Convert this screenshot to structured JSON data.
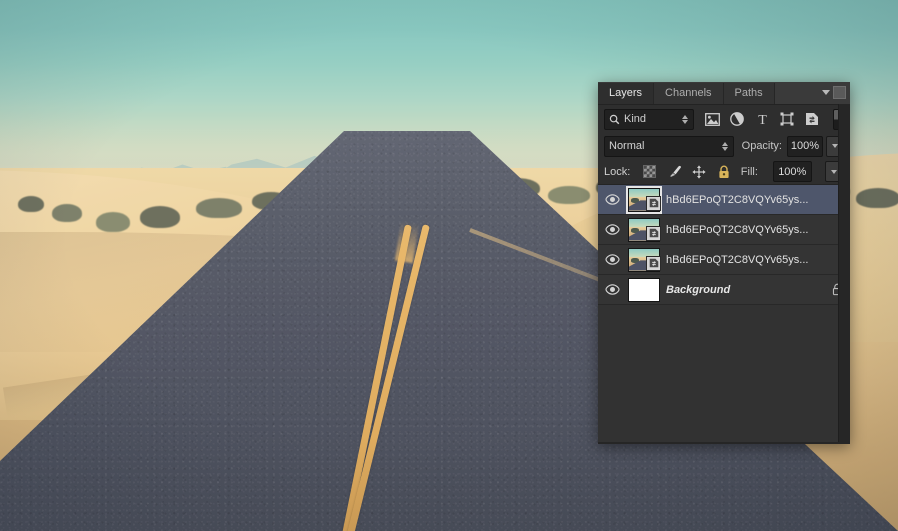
{
  "photo": {
    "description": "desert-road-landscape-photo",
    "colors": {
      "sky_top": "#7fc6c0",
      "sky_bottom": "#f3ddb2",
      "sand": "#e8cb97",
      "asphalt": "#4c5263",
      "center_line": "#e8b86a",
      "mountains": "#8fb2b8"
    }
  },
  "panel": {
    "tabs": [
      {
        "label": "Layers",
        "active": true
      },
      {
        "label": "Channels",
        "active": false
      },
      {
        "label": "Paths",
        "active": false
      }
    ],
    "menu_icon": "panel-menu-icon",
    "filter": {
      "search_icon": "search-icon",
      "kind_label": "Kind",
      "stepper_icon": "stepper-updown-icon",
      "icons": [
        {
          "name": "filter-pixel-layers-icon",
          "glyph": "image"
        },
        {
          "name": "filter-adjustment-layers-icon",
          "glyph": "circle-half"
        },
        {
          "name": "filter-type-layers-icon",
          "glyph": "T"
        },
        {
          "name": "filter-shape-layers-icon",
          "glyph": "shape"
        },
        {
          "name": "filter-smart-objects-icon",
          "glyph": "smart-object"
        }
      ],
      "toggle_name": "filter-enable-toggle"
    },
    "blend": {
      "mode": "Normal",
      "opacity_label": "Opacity:",
      "opacity_value": "100%",
      "fill_label": "Fill:",
      "fill_value": "100%"
    },
    "lock": {
      "label": "Lock:",
      "items": [
        {
          "name": "lock-transparent-pixels-icon"
        },
        {
          "name": "lock-image-pixels-icon"
        },
        {
          "name": "lock-position-icon"
        },
        {
          "name": "lock-all-icon"
        }
      ]
    },
    "layers": [
      {
        "name": "hBd6EPoQT2C8VQYv65ys...",
        "visible": true,
        "selected": true,
        "kind": "smart-object",
        "locked": false
      },
      {
        "name": "hBd6EPoQT2C8VQYv65ys...",
        "visible": true,
        "selected": false,
        "kind": "smart-object",
        "locked": false
      },
      {
        "name": "hBd6EPoQT2C8VQYv65ys...",
        "visible": true,
        "selected": false,
        "kind": "smart-object",
        "locked": false
      },
      {
        "name": "Background",
        "visible": true,
        "selected": false,
        "kind": "background",
        "locked": true
      }
    ]
  }
}
